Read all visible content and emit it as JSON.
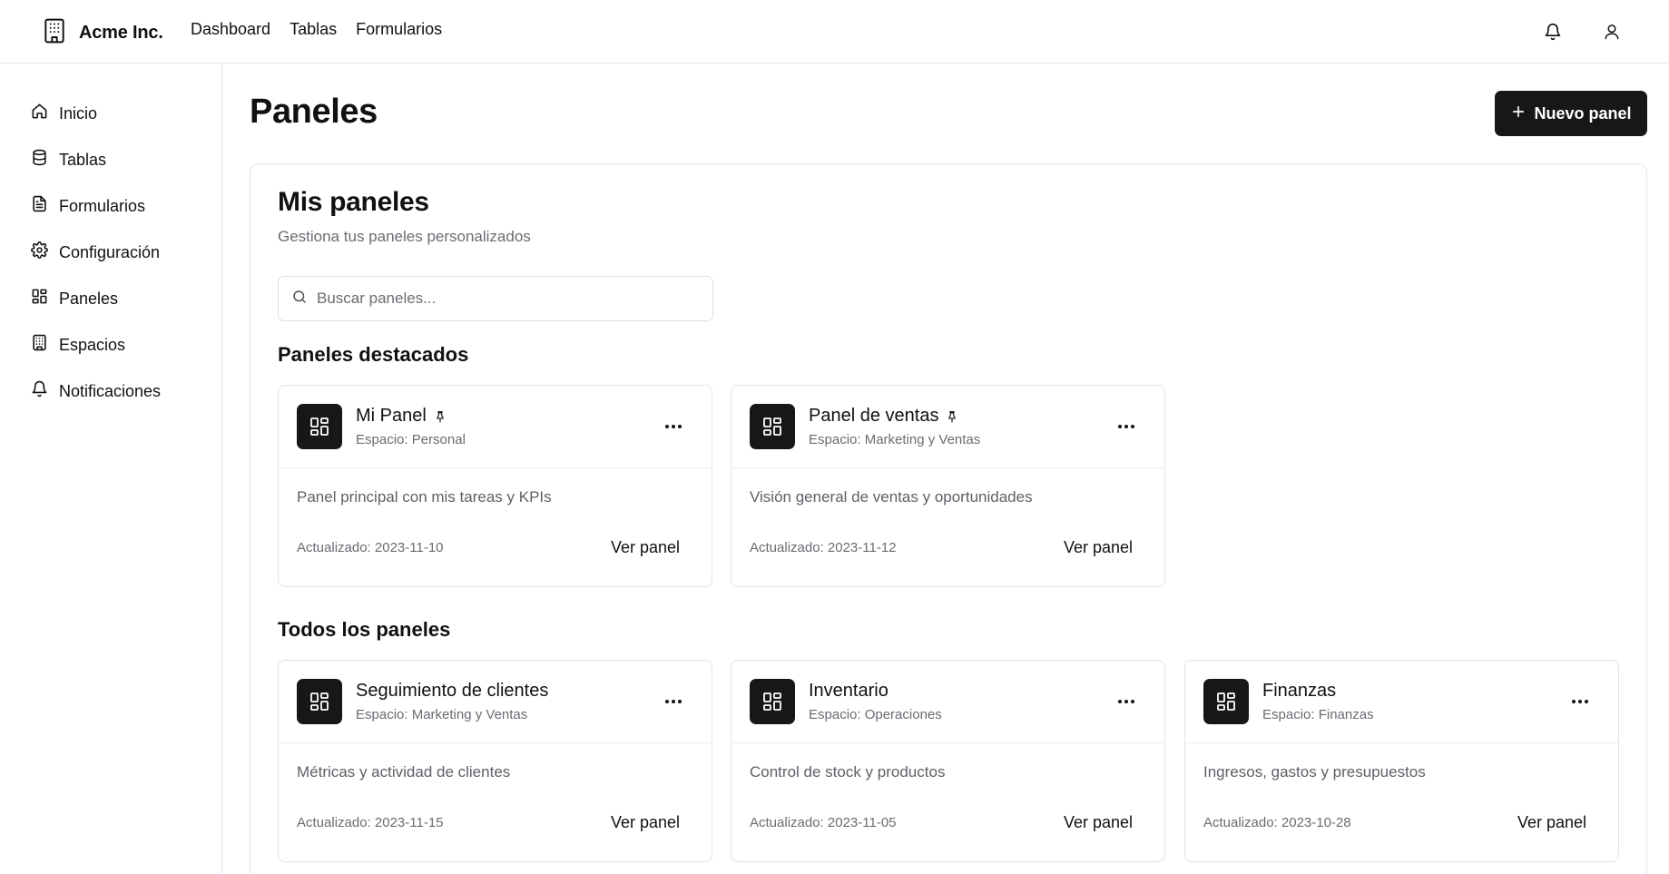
{
  "brand": {
    "name": "Acme Inc.",
    "icon": "building-icon"
  },
  "topnav": [
    {
      "label": "Dashboard"
    },
    {
      "label": "Tablas"
    },
    {
      "label": "Formularios"
    }
  ],
  "topbar_icons": [
    "bell-icon",
    "user-icon"
  ],
  "sidebar": {
    "items": [
      {
        "label": "Inicio",
        "icon": "home-icon"
      },
      {
        "label": "Tablas",
        "icon": "database-icon"
      },
      {
        "label": "Formularios",
        "icon": "file-text-icon"
      },
      {
        "label": "Configuración",
        "icon": "settings-icon"
      },
      {
        "label": "Paneles",
        "icon": "layout-dashboard-icon"
      },
      {
        "label": "Espacios",
        "icon": "building-icon"
      },
      {
        "label": "Notificaciones",
        "icon": "bell-icon"
      }
    ]
  },
  "main": {
    "title": "Paneles",
    "new_button": "Nuevo panel",
    "panel_title": "Mis paneles",
    "panel_subtitle": "Gestiona tus paneles personalizados",
    "search": {
      "placeholder": "Buscar paneles..."
    },
    "featured_heading": "Paneles destacados",
    "all_heading": "Todos los paneles",
    "featured": [
      {
        "title": "Mi Panel",
        "space": "Espacio: Personal",
        "description": "Panel principal con mis tareas y KPIs",
        "updated": "Actualizado: 2023-11-10",
        "link": "Ver panel",
        "pinned": true
      },
      {
        "title": "Panel de ventas",
        "space": "Espacio: Marketing y Ventas",
        "description": "Visión general de ventas y oportunidades",
        "updated": "Actualizado: 2023-11-12",
        "link": "Ver panel",
        "pinned": true
      }
    ],
    "all": [
      {
        "title": "Seguimiento de clientes",
        "space": "Espacio: Marketing y Ventas",
        "description": "Métricas y actividad de clientes",
        "updated": "Actualizado: 2023-11-15",
        "link": "Ver panel",
        "pinned": false
      },
      {
        "title": "Inventario",
        "space": "Espacio: Operaciones",
        "description": "Control de stock y productos",
        "updated": "Actualizado: 2023-11-05",
        "link": "Ver panel",
        "pinned": false
      },
      {
        "title": "Finanzas",
        "space": "Espacio: Finanzas",
        "description": "Ingresos, gastos y presupuestos",
        "updated": "Actualizado: 2023-10-28",
        "link": "Ver panel",
        "pinned": false
      }
    ]
  }
}
